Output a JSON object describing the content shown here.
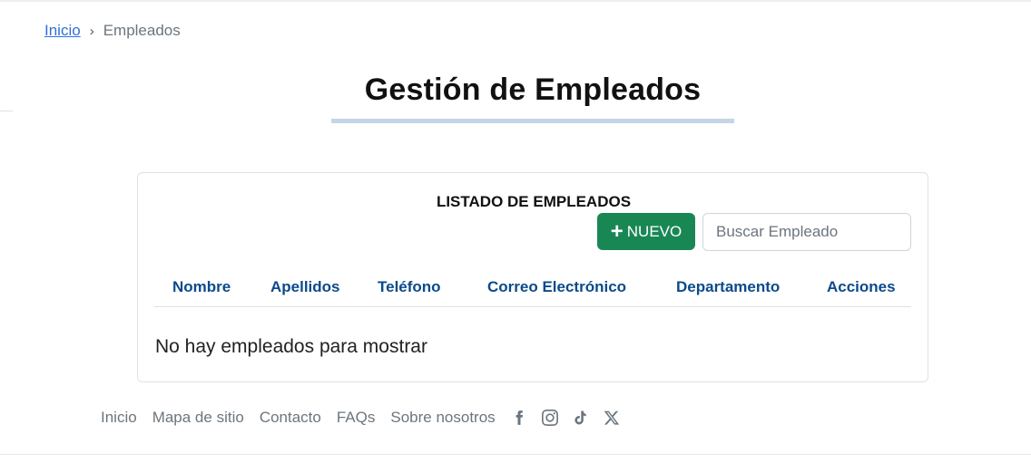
{
  "breadcrumb": {
    "home_label": "Inicio",
    "separator": "›",
    "current_label": "Empleados"
  },
  "page": {
    "title": "Gestión de Empleados"
  },
  "card": {
    "heading": "LISTADO DE EMPLEADOS",
    "new_button_label": "NUEVO",
    "new_button_icon": "plus-icon",
    "search_placeholder": "Buscar Empleado",
    "search_value": "",
    "columns": [
      "Nombre",
      "Apellidos",
      "Teléfono",
      "Correo Electrónico",
      "Departamento",
      "Acciones"
    ],
    "rows": [],
    "empty_message": "No hay empleados para mostrar"
  },
  "footer": {
    "links": [
      "Inicio",
      "Mapa de sitio",
      "Contacto",
      "FAQs",
      "Sobre nosotros"
    ],
    "social_icons": [
      "facebook-icon",
      "instagram-icon",
      "tiktok-icon",
      "x-icon"
    ]
  },
  "colors": {
    "link": "#2f6fdd",
    "accent_green": "#198754",
    "header_blue": "#0b4a8b",
    "title_underline": "#c4d6e6",
    "muted": "#6c757d"
  }
}
